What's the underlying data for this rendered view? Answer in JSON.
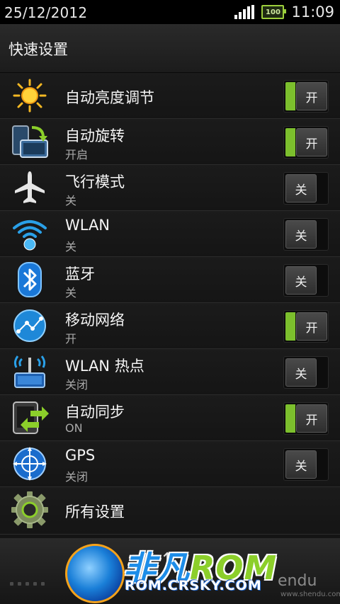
{
  "status_bar": {
    "date": "25/12/2012",
    "battery": "100",
    "time": "11:09"
  },
  "header": {
    "title": "快速设置"
  },
  "settings": [
    {
      "title": "自动亮度调节",
      "sub": "",
      "state": "开",
      "on": true,
      "icon": "sun-icon"
    },
    {
      "title": "自动旋转",
      "sub": "开启",
      "state": "开",
      "on": true,
      "icon": "rotate-icon"
    },
    {
      "title": "飞行模式",
      "sub": "关",
      "state": "关",
      "on": false,
      "icon": "airplane-icon"
    },
    {
      "title": "WLAN",
      "sub": "关",
      "state": "关",
      "on": false,
      "icon": "wifi-icon"
    },
    {
      "title": "蓝牙",
      "sub": "关",
      "state": "关",
      "on": false,
      "icon": "bluetooth-icon"
    },
    {
      "title": "移动网络",
      "sub": "开",
      "state": "开",
      "on": true,
      "icon": "globe-icon"
    },
    {
      "title": "WLAN 热点",
      "sub": "关闭",
      "state": "关",
      "on": false,
      "icon": "hotspot-icon"
    },
    {
      "title": "自动同步",
      "sub": "ON",
      "state": "开",
      "on": true,
      "icon": "sync-icon"
    },
    {
      "title": "GPS",
      "sub": "关闭",
      "state": "关",
      "on": false,
      "icon": "gps-icon"
    }
  ],
  "all_settings": {
    "title": "所有设置",
    "icon": "gear-icon"
  },
  "watermark": {
    "title_cn": "非凡",
    "title_rom": "ROM",
    "url": "ROM.CRSKY.COM",
    "shendu": "endu",
    "shendu_url": "www.shendu.com"
  },
  "colors": {
    "toggle_on": "#7cbf2d",
    "accent_blue": "#1d8de8"
  }
}
